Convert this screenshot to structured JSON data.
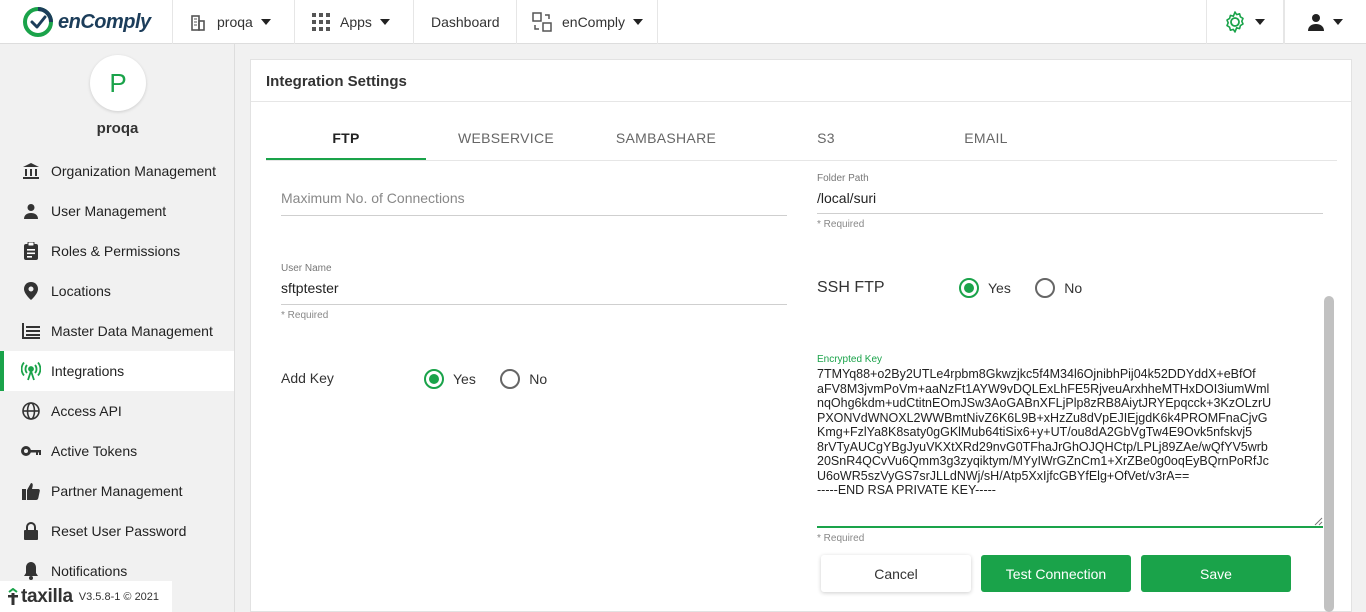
{
  "brand": {
    "name": "enComply"
  },
  "topnav": {
    "org": "proqa",
    "apps": "Apps",
    "dashboard": "Dashboard",
    "product": "enComply"
  },
  "sidebar": {
    "avatar_letter": "P",
    "org_name": "proqa",
    "items": [
      {
        "label": "Organization Management",
        "icon": "bank-icon"
      },
      {
        "label": "User Management",
        "icon": "user-icon"
      },
      {
        "label": "Roles & Permissions",
        "icon": "clipboard-icon"
      },
      {
        "label": "Locations",
        "icon": "map-pin-icon"
      },
      {
        "label": "Master Data Management",
        "icon": "data-icon"
      },
      {
        "label": "Integrations",
        "icon": "broadcast-icon",
        "active": true
      },
      {
        "label": "Access API",
        "icon": "globe-icon"
      },
      {
        "label": "Active Tokens",
        "icon": "key-icon"
      },
      {
        "label": "Partner Management",
        "icon": "thumbs-up-icon"
      },
      {
        "label": "Reset User Password",
        "icon": "lock-icon"
      },
      {
        "label": "Notifications",
        "icon": "bell-icon"
      }
    ],
    "footer_brand": "taxilla",
    "version": "V3.5.8-1 © 2021"
  },
  "main": {
    "title": "Integration Settings",
    "tabs": [
      "FTP",
      "WEBSERVICE",
      "SAMBASHARE",
      "S3",
      "EMAIL"
    ],
    "active_tab": "FTP",
    "max_connections": {
      "placeholder": "Maximum No. of Connections",
      "value": ""
    },
    "folder_path": {
      "label": "Folder Path",
      "value": "/local/suri",
      "hint": "* Required"
    },
    "user_name": {
      "label": "User Name",
      "value": "sftptester",
      "hint": "* Required"
    },
    "ssh_ftp": {
      "label": "SSH FTP",
      "options": [
        "Yes",
        "No"
      ],
      "selected": "Yes"
    },
    "add_key": {
      "label": "Add Key",
      "options": [
        "Yes",
        "No"
      ],
      "selected": "Yes"
    },
    "encrypted_key": {
      "label": "Encrypted Key",
      "hint": "* Required",
      "value": "7TMYq88+o2By2UTLe4rpbm8Gkwzjkc5f4M34l6OjnibhPij04k52DDYddX+eBfOf\naFV8M3jvmPoVm+aaNzFt1AYW9vDQLExLhFE5RjveuArxhheMTHxDOI3iumWml\nnqOhg6kdm+udCtitnEOmJSw3AoGABnXFLjPlp8zRB8AiytJRYEpqcck+3KzOLzrU\nPXONVdWNOXL2WWBmtNivZ6K6L9B+xHzZu8dVpEJIEjgdK6k4PROMFnaCjvG\nKmg+FzlYa8K8saty0gGKlMub64tiSix6+y+UT/ou8dA2GbVgTw4E9Ovk5nfskvj5\n8rVTyAUCgYBgJyuVKXtXRd29nvG0TFhaJrGhOJQHCtp/LPLj89ZAe/wQfYV5wrb\n20SnR4QCvVu6Qmm3g3zyqiktym/MYyIWrGZnCm1+XrZBe0g0oqEyBQrnPoRfJc\nU6oWR5szVyGS7srJLLdNWj/sH/Atp5XxIjfcGBYfElg+OfVet/v3rA==\n-----END RSA PRIVATE KEY-----"
    },
    "buttons": {
      "cancel": "Cancel",
      "test": "Test Connection",
      "save": "Save"
    }
  },
  "colors": {
    "accent": "#1aa34a",
    "text": "#333333",
    "background": "#f1f1f1"
  }
}
